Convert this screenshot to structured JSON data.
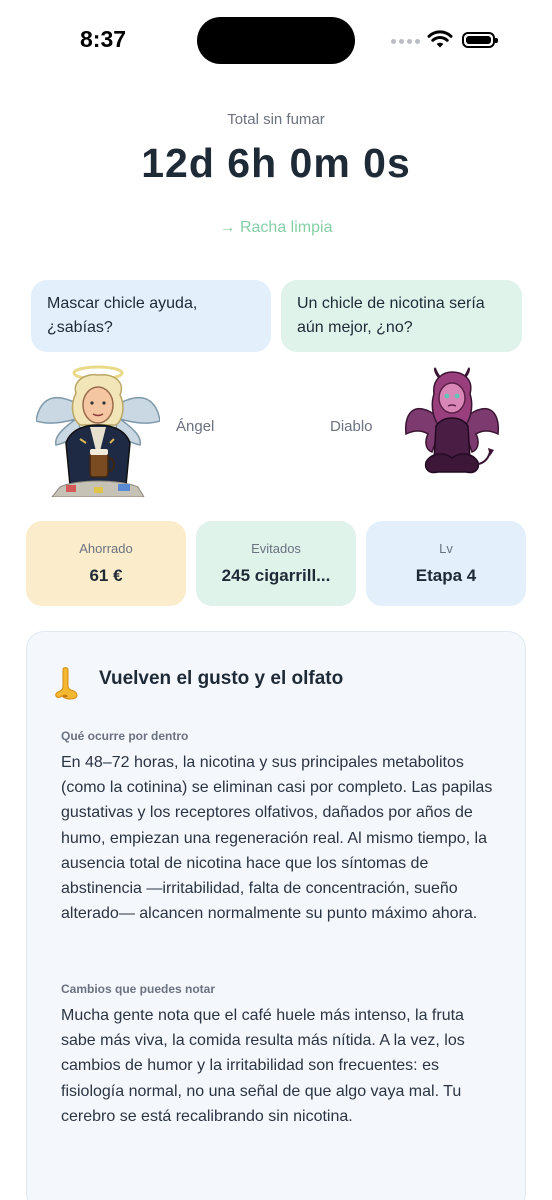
{
  "status_bar": {
    "time": "8:37"
  },
  "counter": {
    "label": "Total sin fumar",
    "value": "12d 6h 0m 0s",
    "streak": "→ Racha limpia"
  },
  "bubbles": {
    "angel": "Mascar chicle ayuda, ¿sabías?",
    "devil": "Un chicle de nicotina sería aún mejor, ¿no?"
  },
  "characters": {
    "angel_name": "Ángel",
    "devil_name": "Diablo"
  },
  "stats": [
    {
      "label": "Ahorrado",
      "value": "61 €"
    },
    {
      "label": "Evitados",
      "value": "245 cigarrill..."
    },
    {
      "label": "Lv",
      "value": "Etapa 4"
    }
  ],
  "info_card": {
    "icon": "nose-icon",
    "title": "Vuelven el gusto y el olfato",
    "sections": [
      {
        "label": "Qué ocurre por dentro",
        "text": "En 48–72 horas, la nicotina y sus principales metabolitos (como la cotinina) se eliminan casi por completo. Las papilas gustativas y los receptores olfativos, dañados por años de humo, empiezan una regeneración real. Al mismo tiempo, la ausencia total de nicotina hace que los síntomas de abstinencia —irritabilidad, falta de concentración, sueño alterado— alcancen normalmente su punto máximo ahora."
      },
      {
        "label": "Cambios que puedes notar",
        "text": "Mucha gente nota que el café huele más intenso, la fruta sabe más viva, la comida resulta más nítida. A la vez, los cambios de humor y la irritabilidad son frecuentes: es fisiología normal, no una señal de que algo vaya mal. Tu cerebro se está recalibrando sin nicotina."
      }
    ]
  },
  "colors": {
    "streak": "#86cfa6",
    "angel_bubble": "#e3f0fb",
    "devil_bubble": "#dff3ea",
    "saved_card": "#fbeccb",
    "avoided_card": "#dff3ea",
    "level_card": "#e3f0fb"
  }
}
